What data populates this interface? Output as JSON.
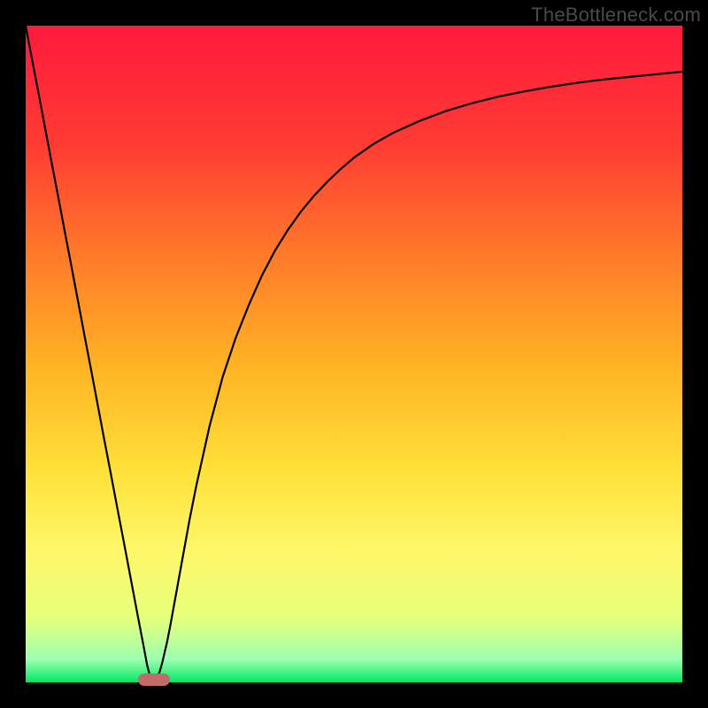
{
  "watermark": "TheBottleneck.com",
  "chart_data": {
    "type": "line",
    "title": "",
    "xlabel": "",
    "ylabel": "",
    "xlim": [
      0,
      100
    ],
    "ylim": [
      0,
      100
    ],
    "grid": false,
    "gradient_stops": [
      {
        "offset": 0.0,
        "color": "#ff1a3d"
      },
      {
        "offset": 0.18,
        "color": "#ff3b33"
      },
      {
        "offset": 0.35,
        "color": "#ff7a2a"
      },
      {
        "offset": 0.52,
        "color": "#ffb424"
      },
      {
        "offset": 0.68,
        "color": "#ffe13a"
      },
      {
        "offset": 0.8,
        "color": "#fff76a"
      },
      {
        "offset": 0.9,
        "color": "#e7ff7a"
      },
      {
        "offset": 0.965,
        "color": "#9dffb0"
      },
      {
        "offset": 1.0,
        "color": "#00e865"
      }
    ],
    "series": [
      {
        "name": "bottleneck-curve",
        "color": "#000000",
        "width": 2.2,
        "x": [
          0.0,
          1.0,
          2.0,
          3.0,
          4.0,
          5.0,
          6.0,
          7.0,
          8.0,
          9.0,
          10.0,
          11.0,
          12.0,
          13.0,
          14.0,
          15.0,
          16.0,
          17.0,
          18.0,
          18.5,
          19.0,
          19.3,
          19.6,
          20.0,
          20.4,
          20.8,
          21.5,
          22.0,
          23.0,
          24.0,
          25.0,
          26.0,
          28.0,
          30.0,
          32.0,
          34.0,
          36.0,
          38.0,
          40.0,
          42.0,
          44.0,
          46.0,
          48.0,
          50.0,
          53.0,
          56.0,
          60.0,
          64.0,
          68.0,
          72.0,
          76.0,
          80.0,
          84.0,
          88.0,
          92.0,
          96.0,
          100.0
        ],
        "y": [
          100.0,
          94.7,
          89.5,
          84.2,
          78.9,
          73.7,
          68.4,
          63.2,
          57.9,
          52.6,
          47.4,
          42.1,
          36.8,
          31.6,
          26.3,
          21.1,
          15.8,
          10.5,
          5.3,
          2.6,
          0.7,
          0.2,
          0.2,
          0.7,
          1.6,
          3.0,
          6.0,
          8.5,
          14.0,
          19.5,
          25.0,
          30.0,
          39.0,
          46.5,
          52.5,
          57.5,
          62.0,
          65.8,
          69.0,
          71.8,
          74.2,
          76.3,
          78.2,
          79.9,
          82.0,
          83.7,
          85.5,
          87.0,
          88.2,
          89.2,
          90.0,
          90.7,
          91.3,
          91.8,
          92.2,
          92.6,
          93.0
        ]
      }
    ],
    "marker": {
      "x": 19.5,
      "y": 0.0,
      "color": "#c46a6a"
    }
  }
}
